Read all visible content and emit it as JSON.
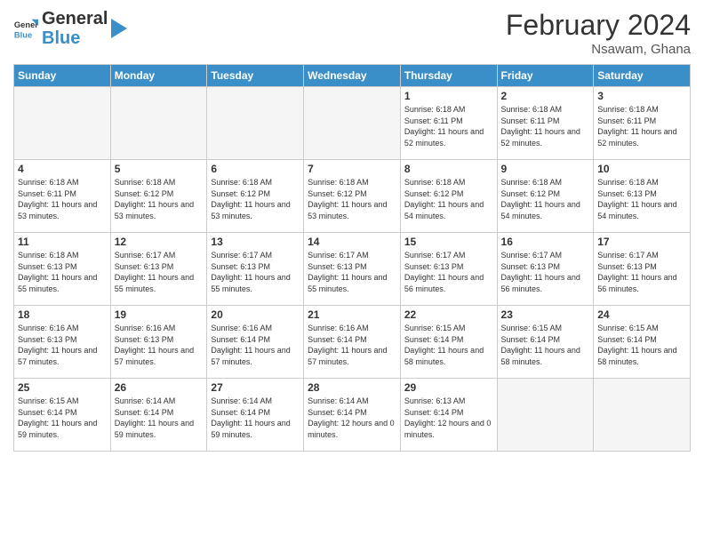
{
  "header": {
    "logo_general": "General",
    "logo_blue": "Blue",
    "month_title": "February 2024",
    "location": "Nsawam, Ghana"
  },
  "days_of_week": [
    "Sunday",
    "Monday",
    "Tuesday",
    "Wednesday",
    "Thursday",
    "Friday",
    "Saturday"
  ],
  "weeks": [
    [
      {
        "day": "",
        "sunrise": "",
        "sunset": "",
        "daylight": "",
        "empty": true
      },
      {
        "day": "",
        "sunrise": "",
        "sunset": "",
        "daylight": "",
        "empty": true
      },
      {
        "day": "",
        "sunrise": "",
        "sunset": "",
        "daylight": "",
        "empty": true
      },
      {
        "day": "",
        "sunrise": "",
        "sunset": "",
        "daylight": "",
        "empty": true
      },
      {
        "day": "1",
        "sunrise": "Sunrise: 6:18 AM",
        "sunset": "Sunset: 6:11 PM",
        "daylight": "Daylight: 11 hours and 52 minutes.",
        "empty": false
      },
      {
        "day": "2",
        "sunrise": "Sunrise: 6:18 AM",
        "sunset": "Sunset: 6:11 PM",
        "daylight": "Daylight: 11 hours and 52 minutes.",
        "empty": false
      },
      {
        "day": "3",
        "sunrise": "Sunrise: 6:18 AM",
        "sunset": "Sunset: 6:11 PM",
        "daylight": "Daylight: 11 hours and 52 minutes.",
        "empty": false
      }
    ],
    [
      {
        "day": "4",
        "sunrise": "Sunrise: 6:18 AM",
        "sunset": "Sunset: 6:11 PM",
        "daylight": "Daylight: 11 hours and 53 minutes.",
        "empty": false
      },
      {
        "day": "5",
        "sunrise": "Sunrise: 6:18 AM",
        "sunset": "Sunset: 6:12 PM",
        "daylight": "Daylight: 11 hours and 53 minutes.",
        "empty": false
      },
      {
        "day": "6",
        "sunrise": "Sunrise: 6:18 AM",
        "sunset": "Sunset: 6:12 PM",
        "daylight": "Daylight: 11 hours and 53 minutes.",
        "empty": false
      },
      {
        "day": "7",
        "sunrise": "Sunrise: 6:18 AM",
        "sunset": "Sunset: 6:12 PM",
        "daylight": "Daylight: 11 hours and 53 minutes.",
        "empty": false
      },
      {
        "day": "8",
        "sunrise": "Sunrise: 6:18 AM",
        "sunset": "Sunset: 6:12 PM",
        "daylight": "Daylight: 11 hours and 54 minutes.",
        "empty": false
      },
      {
        "day": "9",
        "sunrise": "Sunrise: 6:18 AM",
        "sunset": "Sunset: 6:12 PM",
        "daylight": "Daylight: 11 hours and 54 minutes.",
        "empty": false
      },
      {
        "day": "10",
        "sunrise": "Sunrise: 6:18 AM",
        "sunset": "Sunset: 6:13 PM",
        "daylight": "Daylight: 11 hours and 54 minutes.",
        "empty": false
      }
    ],
    [
      {
        "day": "11",
        "sunrise": "Sunrise: 6:18 AM",
        "sunset": "Sunset: 6:13 PM",
        "daylight": "Daylight: 11 hours and 55 minutes.",
        "empty": false
      },
      {
        "day": "12",
        "sunrise": "Sunrise: 6:17 AM",
        "sunset": "Sunset: 6:13 PM",
        "daylight": "Daylight: 11 hours and 55 minutes.",
        "empty": false
      },
      {
        "day": "13",
        "sunrise": "Sunrise: 6:17 AM",
        "sunset": "Sunset: 6:13 PM",
        "daylight": "Daylight: 11 hours and 55 minutes.",
        "empty": false
      },
      {
        "day": "14",
        "sunrise": "Sunrise: 6:17 AM",
        "sunset": "Sunset: 6:13 PM",
        "daylight": "Daylight: 11 hours and 55 minutes.",
        "empty": false
      },
      {
        "day": "15",
        "sunrise": "Sunrise: 6:17 AM",
        "sunset": "Sunset: 6:13 PM",
        "daylight": "Daylight: 11 hours and 56 minutes.",
        "empty": false
      },
      {
        "day": "16",
        "sunrise": "Sunrise: 6:17 AM",
        "sunset": "Sunset: 6:13 PM",
        "daylight": "Daylight: 11 hours and 56 minutes.",
        "empty": false
      },
      {
        "day": "17",
        "sunrise": "Sunrise: 6:17 AM",
        "sunset": "Sunset: 6:13 PM",
        "daylight": "Daylight: 11 hours and 56 minutes.",
        "empty": false
      }
    ],
    [
      {
        "day": "18",
        "sunrise": "Sunrise: 6:16 AM",
        "sunset": "Sunset: 6:13 PM",
        "daylight": "Daylight: 11 hours and 57 minutes.",
        "empty": false
      },
      {
        "day": "19",
        "sunrise": "Sunrise: 6:16 AM",
        "sunset": "Sunset: 6:13 PM",
        "daylight": "Daylight: 11 hours and 57 minutes.",
        "empty": false
      },
      {
        "day": "20",
        "sunrise": "Sunrise: 6:16 AM",
        "sunset": "Sunset: 6:14 PM",
        "daylight": "Daylight: 11 hours and 57 minutes.",
        "empty": false
      },
      {
        "day": "21",
        "sunrise": "Sunrise: 6:16 AM",
        "sunset": "Sunset: 6:14 PM",
        "daylight": "Daylight: 11 hours and 57 minutes.",
        "empty": false
      },
      {
        "day": "22",
        "sunrise": "Sunrise: 6:15 AM",
        "sunset": "Sunset: 6:14 PM",
        "daylight": "Daylight: 11 hours and 58 minutes.",
        "empty": false
      },
      {
        "day": "23",
        "sunrise": "Sunrise: 6:15 AM",
        "sunset": "Sunset: 6:14 PM",
        "daylight": "Daylight: 11 hours and 58 minutes.",
        "empty": false
      },
      {
        "day": "24",
        "sunrise": "Sunrise: 6:15 AM",
        "sunset": "Sunset: 6:14 PM",
        "daylight": "Daylight: 11 hours and 58 minutes.",
        "empty": false
      }
    ],
    [
      {
        "day": "25",
        "sunrise": "Sunrise: 6:15 AM",
        "sunset": "Sunset: 6:14 PM",
        "daylight": "Daylight: 11 hours and 59 minutes.",
        "empty": false
      },
      {
        "day": "26",
        "sunrise": "Sunrise: 6:14 AM",
        "sunset": "Sunset: 6:14 PM",
        "daylight": "Daylight: 11 hours and 59 minutes.",
        "empty": false
      },
      {
        "day": "27",
        "sunrise": "Sunrise: 6:14 AM",
        "sunset": "Sunset: 6:14 PM",
        "daylight": "Daylight: 11 hours and 59 minutes.",
        "empty": false
      },
      {
        "day": "28",
        "sunrise": "Sunrise: 6:14 AM",
        "sunset": "Sunset: 6:14 PM",
        "daylight": "Daylight: 12 hours and 0 minutes.",
        "empty": false
      },
      {
        "day": "29",
        "sunrise": "Sunrise: 6:13 AM",
        "sunset": "Sunset: 6:14 PM",
        "daylight": "Daylight: 12 hours and 0 minutes.",
        "empty": false
      },
      {
        "day": "",
        "sunrise": "",
        "sunset": "",
        "daylight": "",
        "empty": true
      },
      {
        "day": "",
        "sunrise": "",
        "sunset": "",
        "daylight": "",
        "empty": true
      }
    ]
  ]
}
